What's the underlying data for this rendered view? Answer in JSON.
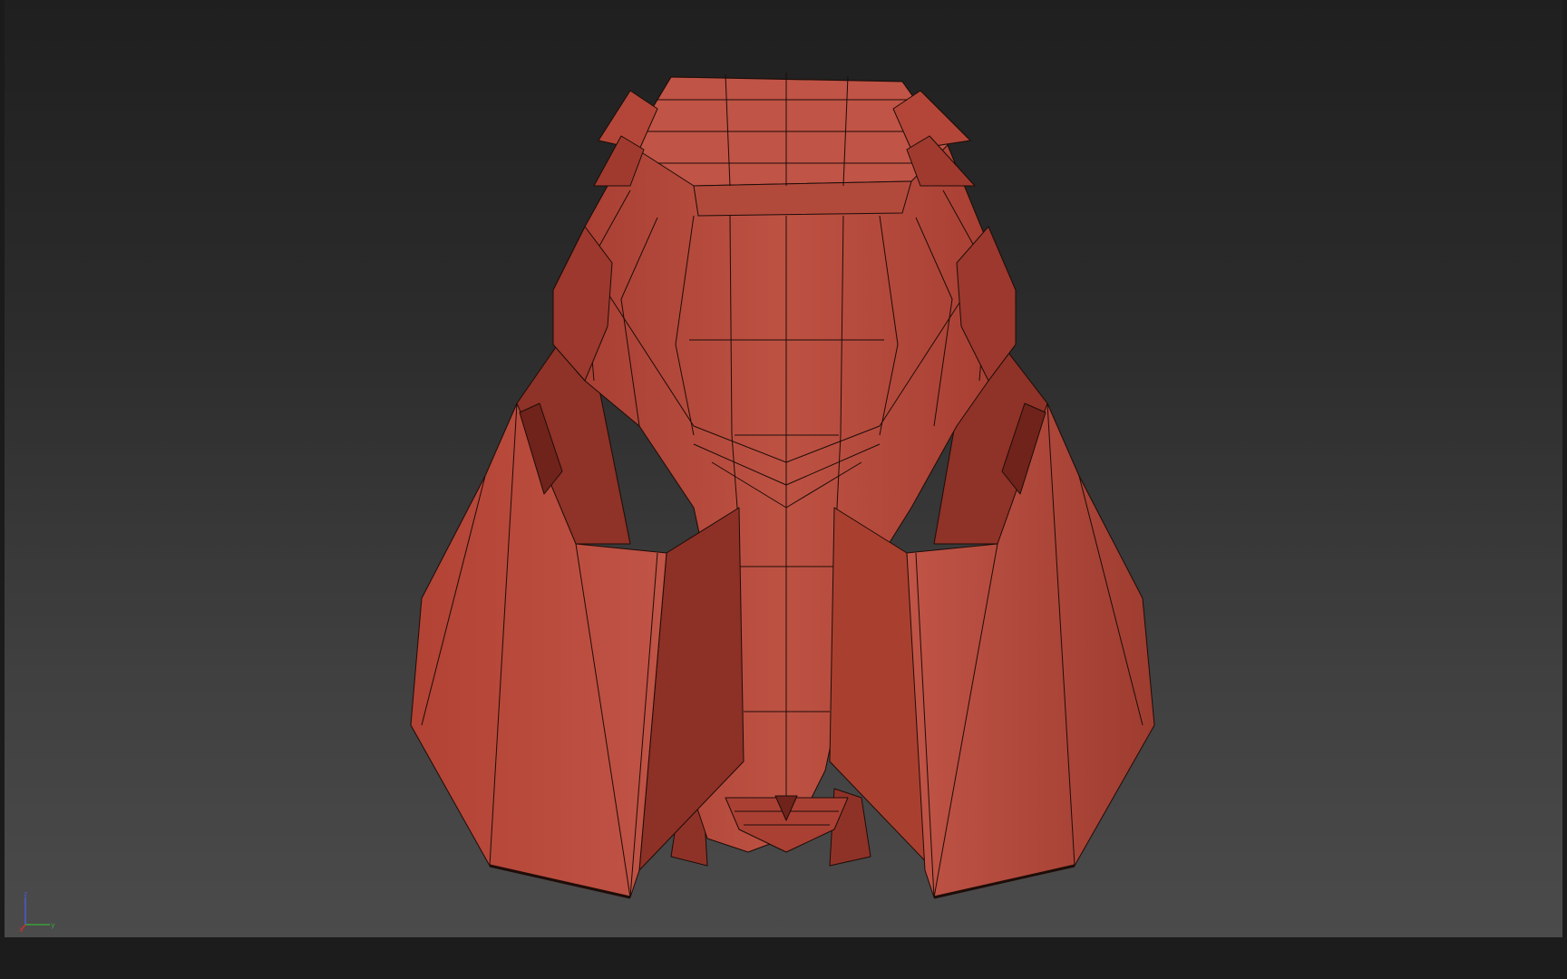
{
  "viewport": {
    "view_mode": "perspective",
    "shading": "edged-faces",
    "model_color": "#b84a3c",
    "wire_color": "#1e0c08",
    "background_top": "#1f1f1f",
    "background_bottom": "#4b4b4b"
  },
  "axis_gizmo": {
    "z_label": "z",
    "y_label": "y",
    "x_label": "x",
    "z_color": "#4a5bd8",
    "y_color": "#3aa03a",
    "x_color": "#d03030"
  }
}
